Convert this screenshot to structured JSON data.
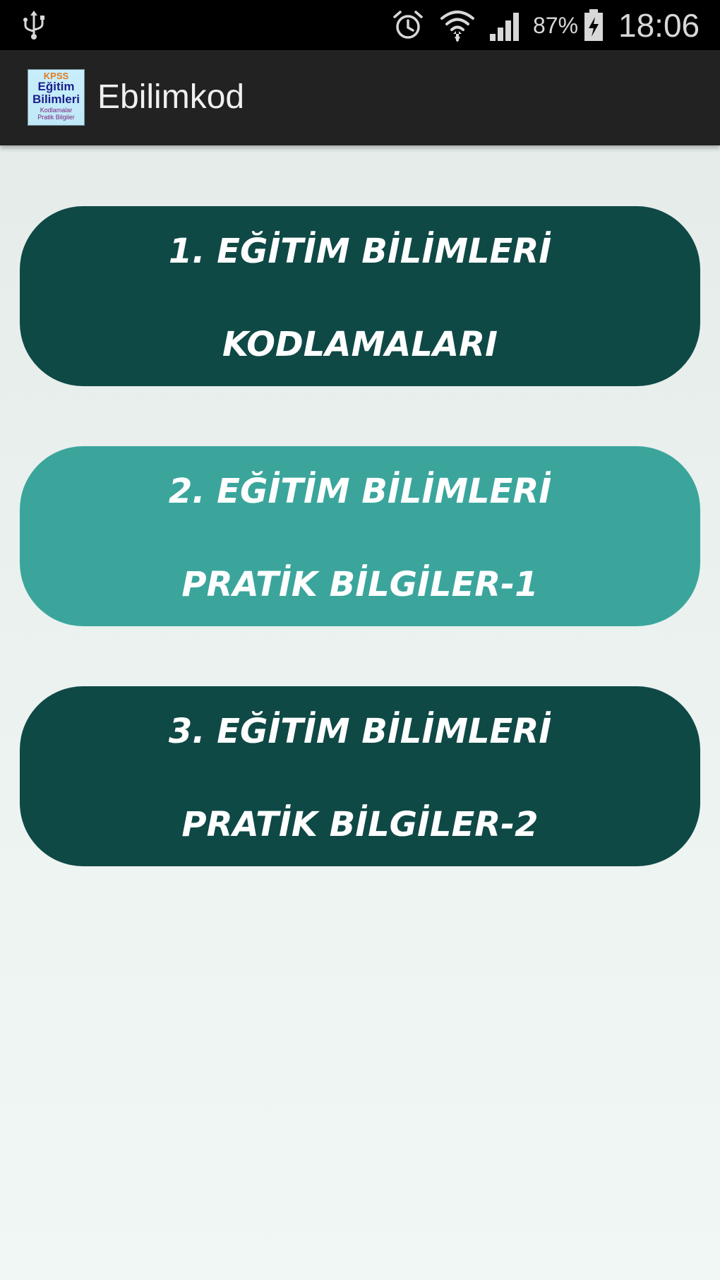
{
  "status_bar": {
    "usb_icon": "usb-icon",
    "alarm_icon": "alarm-clock-icon",
    "wifi_icon": "wifi-icon",
    "signal_icon": "cell-signal-icon",
    "battery_percent": "87%",
    "battery_icon": "battery-charging-icon",
    "time": "18:06"
  },
  "action_bar": {
    "logo": {
      "line1": "KPSS",
      "line2": "Eğitim",
      "line3": "Bilimleri",
      "line4": "Kodlamalar",
      "line5": "Pratik Bilgiler"
    },
    "title": "Ebilimkod"
  },
  "menu": {
    "items": [
      {
        "line1": "1. EĞİTİM BİLİMLERİ",
        "line2": "KODLAMALARI",
        "color": "#0f4945"
      },
      {
        "line1": "2. EĞİTİM BİLİMLERİ",
        "line2": "PRATİK BİLGİLER-1",
        "color": "#3ba59c"
      },
      {
        "line1": "3. EĞİTİM BİLİMLERİ",
        "line2": "PRATİK BİLGİLER-2",
        "color": "#0f4945"
      }
    ]
  },
  "colors": {
    "status_bar_bg": "#000000",
    "action_bar_bg": "#222222",
    "button_dark": "#0f4945",
    "button_teal": "#3ba59c",
    "page_bg": "#e8efed"
  }
}
